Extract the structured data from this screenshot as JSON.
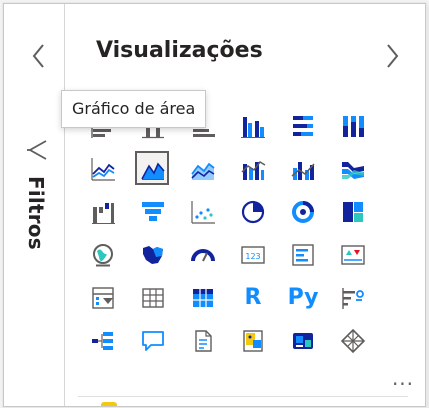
{
  "filters_pane": {
    "label": "Filtros"
  },
  "visualizations": {
    "title": "Visualizações",
    "tooltip": "Gráfico de área",
    "icons": [
      "stacked-bar-chart-icon",
      "stacked-column-chart-icon",
      "clustered-bar-chart-icon",
      "clustered-column-chart-icon",
      "100-stacked-bar-chart-icon",
      "100-stacked-column-chart-icon",
      "line-chart-icon",
      "area-chart-icon",
      "stacked-area-chart-icon",
      "line-and-stacked-column-chart-icon",
      "line-and-clustered-column-chart-icon",
      "ribbon-chart-icon",
      "waterfall-chart-icon",
      "funnel-icon",
      "scatter-chart-icon",
      "pie-chart-icon",
      "donut-chart-icon",
      "treemap-icon",
      "map-icon",
      "filled-map-icon",
      "gauge-icon",
      "card-icon",
      "multi-row-card-icon",
      "kpi-icon",
      "slicer-icon",
      "table-icon",
      "matrix-icon",
      "r-script-visual-icon",
      "python-visual-icon",
      "key-influencers-icon",
      "decomposition-tree-icon",
      "qa-icon",
      "smart-narrative-icon",
      "paginated-report-icon",
      "power-apps-icon",
      "more-visuals-icon"
    ],
    "text_icons": {
      "card": "123",
      "r": "R",
      "py": "Py",
      "more": "···"
    },
    "selected": "area-chart-icon"
  },
  "colors": {
    "accent": "#118dff",
    "dark": "#12239e",
    "teal": "#2dc7bf",
    "yellow": "#f2c811",
    "gray": "#605e5c"
  }
}
